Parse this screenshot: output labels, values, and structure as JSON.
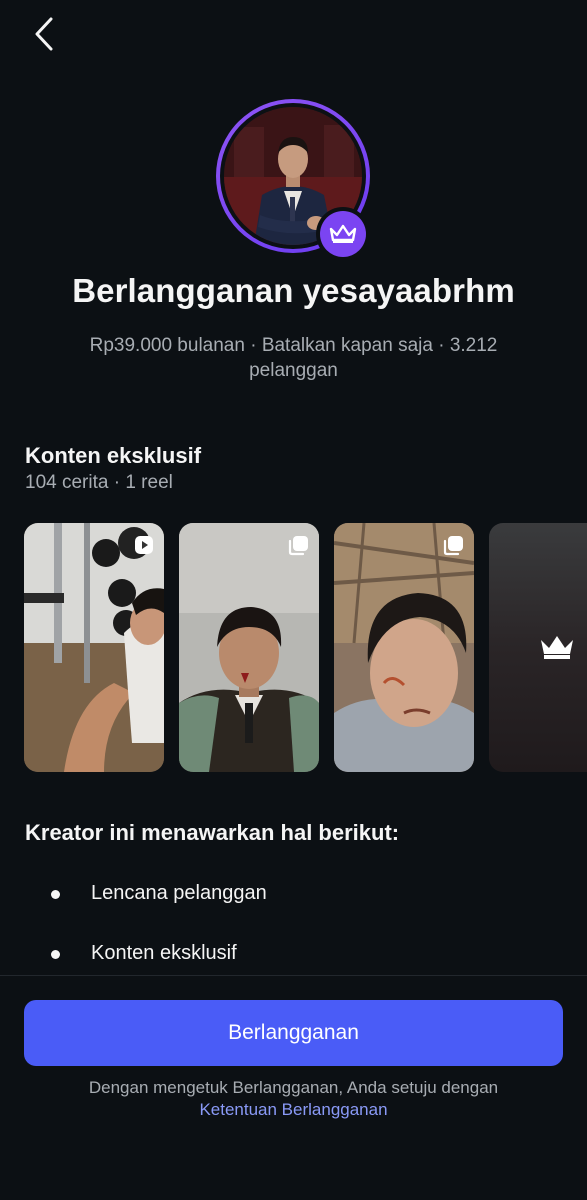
{
  "header": {
    "back_icon": "chevron-left-icon"
  },
  "profile": {
    "badge_icon": "crown-icon",
    "title": "Berlangganan yesayaabrhm",
    "subtitle": "Rp39.000 bulanan · Batalkan kapan saja · 3.212 pelanggan"
  },
  "exclusive": {
    "title": "Konten eksklusif",
    "counts": "104 cerita · 1 reel",
    "items": [
      {
        "scene": "gym selfie",
        "icon": "reel-icon"
      },
      {
        "scene": "portrait in suit",
        "icon": "multiple-posts-icon"
      },
      {
        "scene": "close-up face",
        "icon": "multiple-posts-icon"
      },
      {
        "scene": "locked",
        "icon": "crown-icon"
      }
    ]
  },
  "offers": {
    "title": "Kreator ini menawarkan hal berikut:",
    "items": [
      "Lencana pelanggan",
      "Konten eksklusif"
    ]
  },
  "footer": {
    "subscribe_label": "Berlangganan",
    "terms_text": "Dengan mengetuk Berlangganan, Anda setuju dengan",
    "terms_link": "Ketentuan Berlangganan"
  },
  "colors": {
    "background": "#0c1014",
    "accent": "#4a5cf7",
    "ring": "#7b44f2",
    "muted_text": "#a8adb3",
    "link": "#8a9af7"
  }
}
